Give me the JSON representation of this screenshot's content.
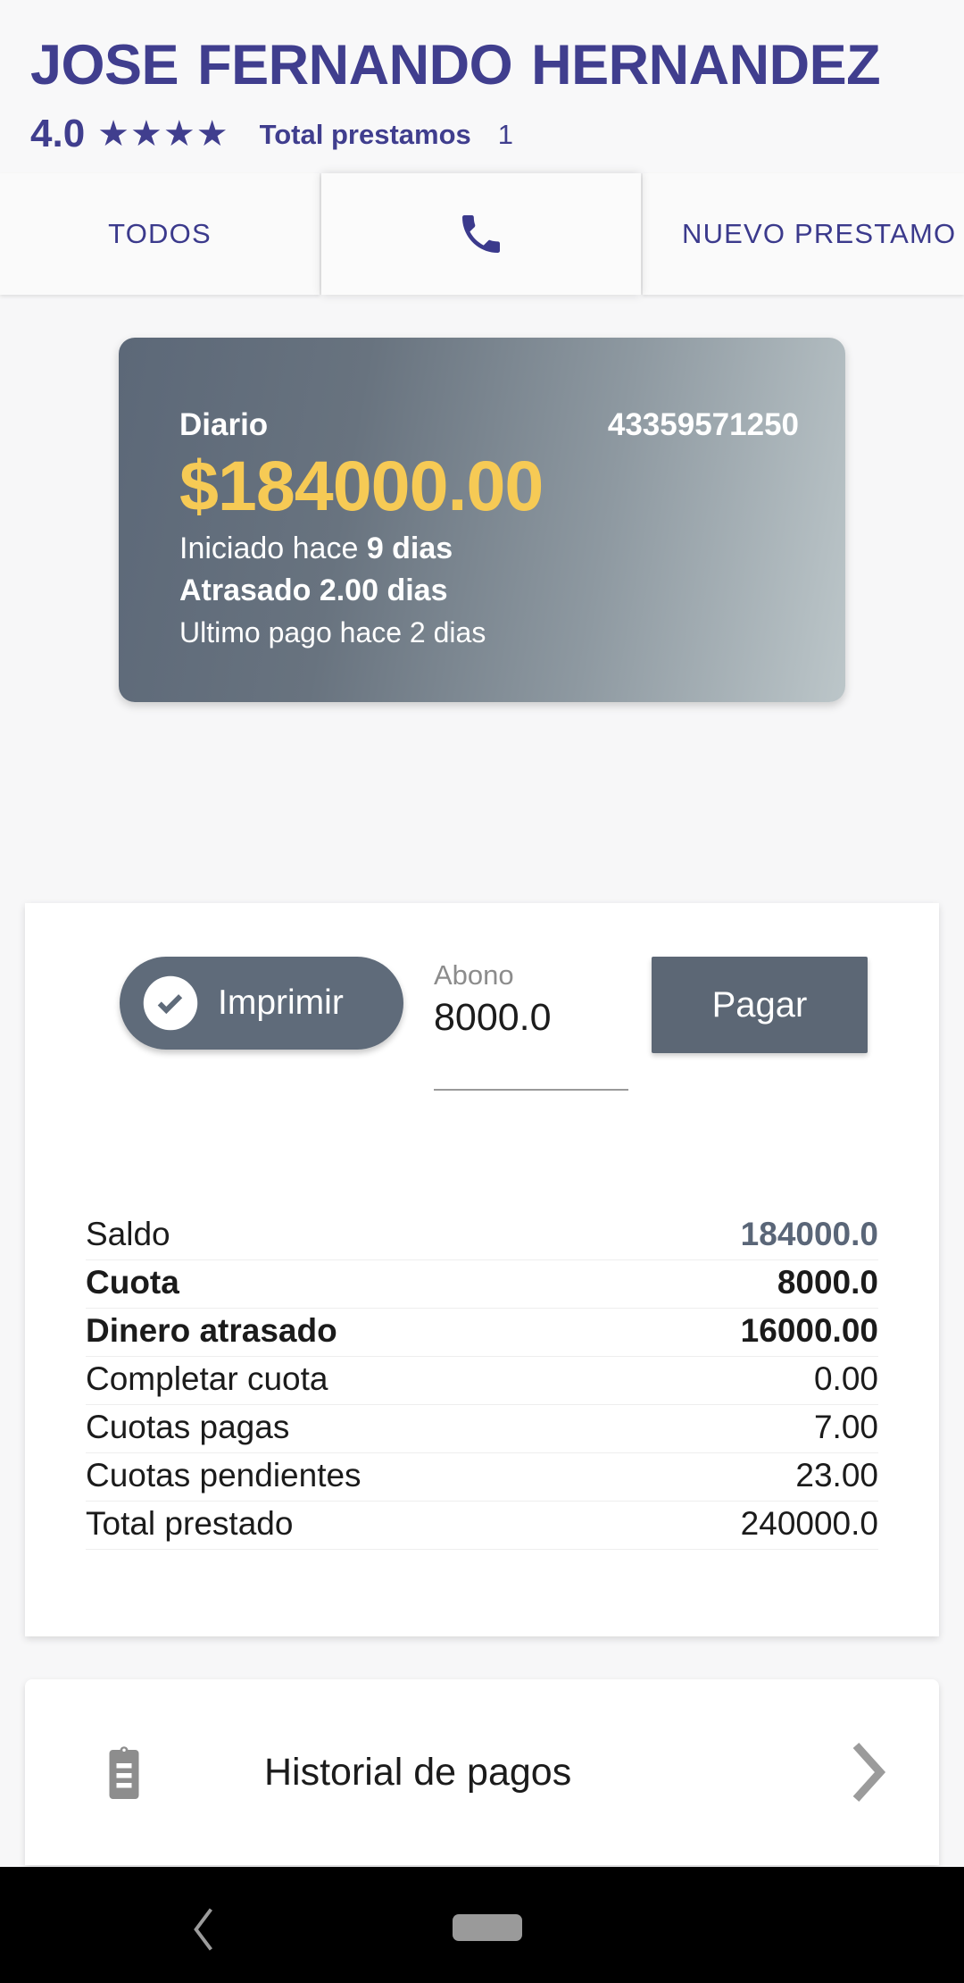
{
  "header": {
    "client_name": "JOSE FERNANDO HERNANDEZ",
    "rating_value": "4.0",
    "stars": "★★★★",
    "total_loans_label": "Total prestamos",
    "total_loans_count": "1"
  },
  "tabs": [
    {
      "label": "TODOS",
      "icon": ""
    },
    {
      "label": "",
      "icon": "phone-icon"
    },
    {
      "label": "NUEVO PRESTAMO",
      "icon": ""
    }
  ],
  "loan_card": {
    "type": "Diario",
    "reference": "43359571250",
    "amount": "$184000.00",
    "started_prefix": "Iniciado hace ",
    "started_value": "9 dias",
    "overdue": "Atrasado 2.00 dias",
    "last_payment": "Ultimo pago hace 2 dias"
  },
  "actions": {
    "print_label": "Imprimir",
    "print_icon": "check-circle-icon",
    "abono_label": "Abono",
    "abono_value": "8000.0",
    "pay_label": "Pagar"
  },
  "summary": {
    "rows": [
      {
        "label": "Saldo",
        "value": "184000.0",
        "style": "accent"
      },
      {
        "label": "Cuota",
        "value": "8000.0",
        "style": "strong"
      },
      {
        "label": "Dinero atrasado",
        "value": "16000.00",
        "style": "strong"
      },
      {
        "label": "Completar cuota",
        "value": "0.00",
        "style": "normal"
      },
      {
        "label": "Cuotas pagas",
        "value": "7.00",
        "style": "normal"
      },
      {
        "label": "Cuotas pendientes",
        "value": "23.00",
        "style": "normal"
      },
      {
        "label": "Total prestado",
        "value": "240000.0",
        "style": "normal"
      }
    ]
  },
  "history": {
    "label": "Historial de pagos",
    "icon": "clipboard-icon",
    "chevron": "chevron-right-icon"
  },
  "navbar": {
    "back_icon": "back-chevron-icon",
    "home_icon": "home-pill-icon"
  },
  "colors": {
    "brand_indigo": "#403e8e",
    "amount_amber": "#f6ca55",
    "slate": "#5f6b7a",
    "page_bg": "#f7f7f8"
  }
}
